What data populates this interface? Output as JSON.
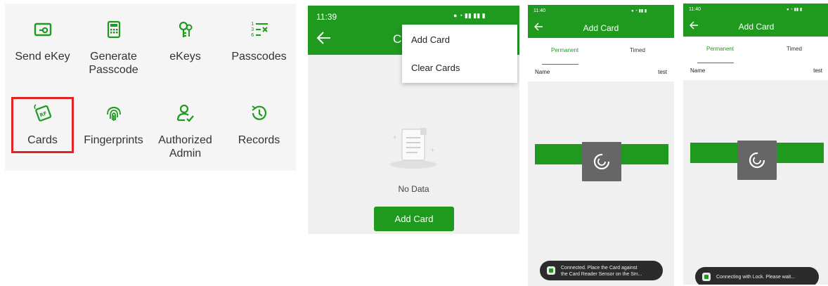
{
  "menu_grid": {
    "items": [
      {
        "label": "Send eKey",
        "icon": "send-ekey-icon"
      },
      {
        "label": "Generate Passcode",
        "icon": "generate-passcode-icon"
      },
      {
        "label": "eKeys",
        "icon": "ekeys-icon"
      },
      {
        "label": "Passcodes",
        "icon": "passcodes-icon"
      },
      {
        "label": "Cards",
        "icon": "cards-icon"
      },
      {
        "label": "Fingerprints",
        "icon": "fingerprint-icon"
      },
      {
        "label": "Authorized Admin",
        "icon": "authorized-admin-icon"
      },
      {
        "label": "Records",
        "icon": "records-icon"
      }
    ],
    "highlighted_item": "Cards",
    "accent_color": "#1f9a1f",
    "highlight_color": "#e02424"
  },
  "cards_screen": {
    "status_time": "11:39",
    "title_peek": "C",
    "overflow_menu": [
      "Add Card",
      "Clear Cards"
    ],
    "empty_text": "No Data",
    "add_button": "Add Card",
    "header_color": "#1f9a1f"
  },
  "add_card_connected": {
    "status_time": "11:40",
    "title": "Add Card",
    "tabs": [
      "Permanent",
      "Timed"
    ],
    "active_tab": "Permanent",
    "name_label": "Name",
    "name_value": "test",
    "toast_line1": "Connected. Place the Card against",
    "toast_line2": "the Card Reader Sensor on the Sm..."
  },
  "add_card_connecting": {
    "status_time": "11:40",
    "title": "Add Card",
    "tabs": [
      "Permanent",
      "Timed"
    ],
    "active_tab": "Permanent",
    "name_label": "Name",
    "name_value": "test",
    "toast": "Connecting with Lock. Please wait..."
  }
}
